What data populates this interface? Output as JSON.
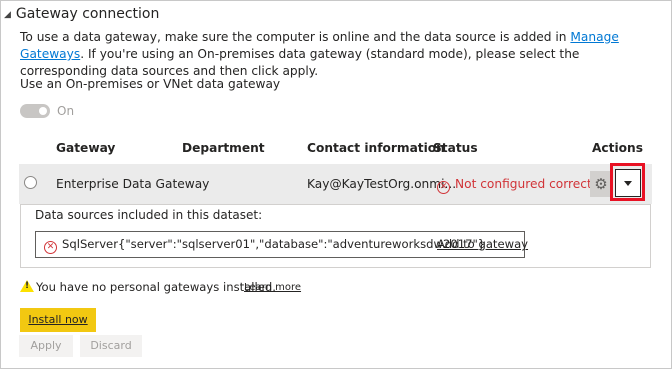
{
  "section": {
    "title": "Gateway connection",
    "desc_part1": "To use a data gateway, make sure the computer is online and the data source is added in ",
    "manage_link": "Manage Gateways",
    "desc_part2": ". If you're using an On-premises data gateway (standard mode), please select the corresponding data sources and then click apply."
  },
  "toggle": {
    "label": "Use an On-premises or VNet data gateway",
    "state_label": "On"
  },
  "table": {
    "headers": [
      "Gateway",
      "Department",
      "Contact information",
      "Status",
      "Actions"
    ],
    "row": {
      "gateway": "Enterprise Data Gateway",
      "department": "",
      "contact": "Kay@KayTestOrg.onmi...",
      "status": "Not configured correctly"
    }
  },
  "datasources": {
    "label": "Data sources included in this dataset:",
    "item": "SqlServer{\"server\":\"sqlserver01\",\"database\":\"adventureworksdw2017\"}",
    "add_link": "Add to gateway"
  },
  "personal": {
    "warning": "You have no personal gateways installed.",
    "learn_more": "Learn more",
    "install_label": "Install now"
  },
  "footer": {
    "apply_label": "Apply",
    "discard_label": "Discard"
  },
  "icons": {
    "collapse": "triangle-down-icon",
    "error": "error-circle-icon",
    "settings": "gear-icon",
    "expand": "caret-down-icon",
    "warning": "warning-icon"
  },
  "colors": {
    "link": "#0078d4",
    "error": "#d13438",
    "highlight": "#e81123",
    "install_button": "#f2c811"
  }
}
